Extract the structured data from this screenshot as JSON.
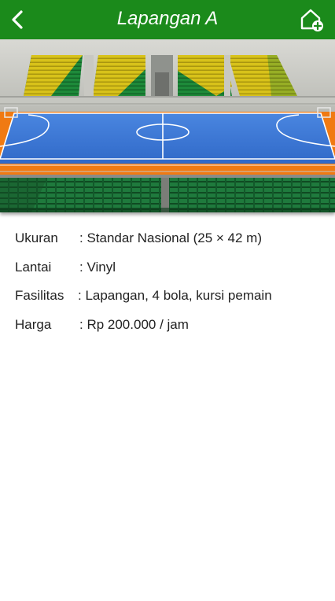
{
  "header": {
    "title": "Lapangan A",
    "back_icon": "chevron-left-icon",
    "action_icon": "home-add-icon",
    "color": "#1b8a1b"
  },
  "venue_image": {
    "subject": "indoor futsal court with green and yellow stadium seats",
    "court_color": "#3b78d8",
    "border_color": "#f07a12"
  },
  "details": [
    {
      "label": "Ukuran",
      "value": ": Standar Nasional (25 × 42 m)"
    },
    {
      "label": "Lantai",
      "value": ": Vinyl"
    },
    {
      "label": "Fasilitas",
      "value": ": Lapangan, 4 bola, kursi pemain"
    },
    {
      "label": "Harga",
      "value": ": Rp 200.000 / jam"
    }
  ]
}
